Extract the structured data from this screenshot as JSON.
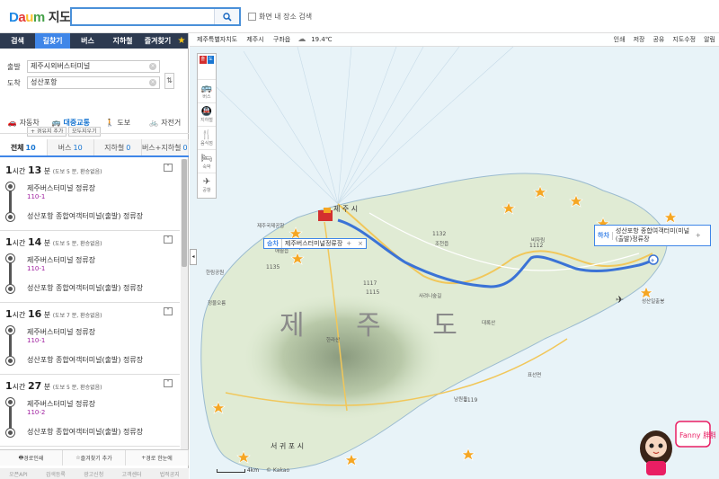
{
  "header": {
    "logo_text": "Daum",
    "logo_label": "지도",
    "search_value": "",
    "checkbox_label": "화면 내 장소 검색"
  },
  "sidebar": {
    "tabs": [
      {
        "label": "검색"
      },
      {
        "label": "길찾기"
      },
      {
        "label": "버스"
      },
      {
        "label": "지하철"
      },
      {
        "label": "즐겨찾기"
      }
    ],
    "origin_label": "출발",
    "origin_value": "제주시외버스터미널",
    "dest_label": "도착",
    "dest_value": "성산포항",
    "add_waypoint": "+ 경유지 추가",
    "clear_all": "모두지우기",
    "modes": [
      {
        "label": "자동차",
        "icon": "car-icon"
      },
      {
        "label": "대중교통",
        "icon": "transit-icon"
      },
      {
        "label": "도보",
        "icon": "walk-icon"
      },
      {
        "label": "자전거",
        "icon": "bike-icon"
      }
    ],
    "filters": [
      {
        "label": "전체",
        "count": "10"
      },
      {
        "label": "버스",
        "count": "10"
      },
      {
        "label": "지하철",
        "count": "0"
      },
      {
        "label": "버스+지하철",
        "count": "0"
      }
    ],
    "routes": [
      {
        "hours": "1",
        "hour_unit": "시간",
        "mins": "13",
        "min_unit": "분",
        "note": "(도보 5 분, 환승없음)",
        "from": "제주버스터미널 정류장",
        "bus": "110-1",
        "to": "성산포항 종합여객터미널(출발) 정류장"
      },
      {
        "hours": "1",
        "hour_unit": "시간",
        "mins": "14",
        "min_unit": "분",
        "note": "(도보 5 분, 환승없음)",
        "from": "제주버스터미널 정류장",
        "bus": "110-1",
        "to": "성산포항 종합여객터미널(출발) 정류장"
      },
      {
        "hours": "1",
        "hour_unit": "시간",
        "mins": "16",
        "min_unit": "분",
        "note": "(도보 7 분, 환승없음)",
        "from": "제주버스터미널 정류장",
        "bus": "110-1",
        "to": "성산포항 종합여객터미널(출발) 정류장"
      },
      {
        "hours": "1",
        "hour_unit": "시간",
        "mins": "27",
        "min_unit": "분",
        "note": "(도보 5 분, 환승없음)",
        "from": "제주버스터미널 정류장",
        "bus": "110-2",
        "to": "성산포항 종합여객터미널(출발) 정류장"
      }
    ],
    "actions": [
      {
        "label": "경로인쇄"
      },
      {
        "label": "즐겨찾기 추가"
      },
      {
        "label": "경로 한눈에"
      }
    ],
    "footer": [
      "오픈API",
      "검색등록",
      "광고신청",
      "고객센터",
      "법적공지"
    ]
  },
  "map": {
    "breadcrumb": [
      "제주특별자치도",
      "제주시",
      "구좌읍"
    ],
    "temperature": "19.4℃",
    "menu": [
      "인쇄",
      "저장",
      "공유",
      "지도수정",
      "알림"
    ],
    "toolbar_start": "출발",
    "toolbar_end": "도착",
    "toolbar_items": [
      {
        "label": "버스",
        "icon": "bus-icon"
      },
      {
        "label": "지하철",
        "icon": "subway-icon"
      },
      {
        "label": "음식점",
        "icon": "restaurant-icon"
      },
      {
        "label": "숙박",
        "icon": "bed-icon"
      },
      {
        "label": "공항",
        "icon": "airport-icon"
      }
    ],
    "island_label": "제 주 도",
    "city_north": "제 주 시",
    "city_south": "서 귀 포 시",
    "place_labels": [
      "성산포항 종합여객터미널(출발) 정류장",
      "비자림",
      "한라산",
      "조천읍",
      "남원읍",
      "표선면",
      "성산일출봉",
      "대록산",
      "정물오름",
      "한림공원",
      "애월읍",
      "제주국제공항",
      "사려니숲길"
    ],
    "board_tag": "승차",
    "board_label": "제주버스터미널정류장",
    "alight_tag": "하차",
    "alight_label": "성산포항 종합여객터미(미널(출발)정류장",
    "scale_label": "4km",
    "copyright": "© Kakao",
    "mascot_text": "Fanny 胖胖",
    "accent_color": "#3f86e8",
    "route_color": "#3b73d6"
  }
}
